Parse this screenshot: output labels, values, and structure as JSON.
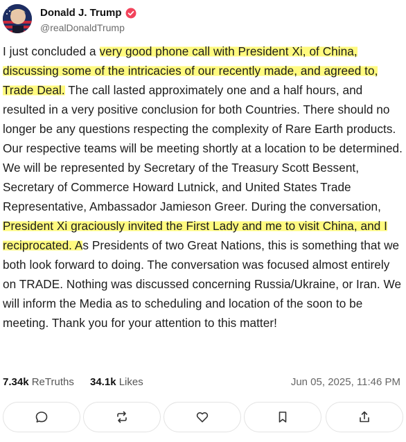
{
  "author": {
    "display_name": "Donald J. Trump",
    "handle": "@realDonaldTrump",
    "verified_badge_color": "#f2435b"
  },
  "post": {
    "segments": [
      {
        "text": "I just concluded a ",
        "highlight": false
      },
      {
        "text": "very good phone call with President Xi, of China, discussing some of the intricacies of our recently made, and agreed to, Trade Deal.",
        "highlight": true
      },
      {
        "text": " The call lasted approximately one and a half hours, and resulted in a very positive conclusion for both Countries. There should no longer be any questions respecting the complexity of Rare Earth products. Our respective teams will be meeting shortly at a location to be determined. We will be represented by Secretary of the Treasury Scott Bessent, Secretary of Commerce Howard Lutnick, and United States Trade Representative, Ambassador Jamieson Greer. During the conversation, ",
        "highlight": false
      },
      {
        "text": "President Xi graciously invited the First Lady and me to visit China, and I reciprocated. A",
        "highlight": true
      },
      {
        "text": "s Presidents of two Great Nations, this is something that we both look forward to doing. The conversation was focused almost entirely on TRADE. Nothing was discussed concerning Russia/Ukraine, or Iran. We will inform the Media as to scheduling and location of the soon to be meeting. Thank you for your attention to this matter!",
        "highlight": false
      }
    ],
    "highlight_color": "#fffa78"
  },
  "stats": {
    "retruths_count": "7.34k",
    "retruths_label": "ReTruths",
    "likes_count": "34.1k",
    "likes_label": "Likes",
    "timestamp": "Jun 05, 2025, 11:46 PM"
  },
  "actions": [
    {
      "icon": "reply-icon"
    },
    {
      "icon": "retruth-icon"
    },
    {
      "icon": "like-heart-icon"
    },
    {
      "icon": "bookmark-icon"
    },
    {
      "icon": "share-icon"
    }
  ]
}
